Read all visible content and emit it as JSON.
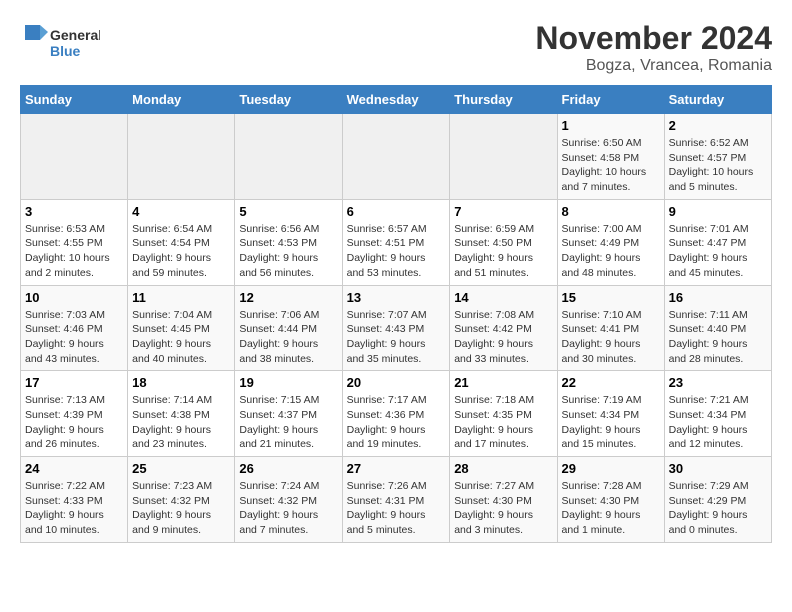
{
  "logo": {
    "line1": "General",
    "line2": "Blue"
  },
  "title": "November 2024",
  "location": "Bogza, Vrancea, Romania",
  "weekdays": [
    "Sunday",
    "Monday",
    "Tuesday",
    "Wednesday",
    "Thursday",
    "Friday",
    "Saturday"
  ],
  "weeks": [
    [
      {
        "day": "",
        "info": ""
      },
      {
        "day": "",
        "info": ""
      },
      {
        "day": "",
        "info": ""
      },
      {
        "day": "",
        "info": ""
      },
      {
        "day": "",
        "info": ""
      },
      {
        "day": "1",
        "info": "Sunrise: 6:50 AM\nSunset: 4:58 PM\nDaylight: 10 hours\nand 7 minutes."
      },
      {
        "day": "2",
        "info": "Sunrise: 6:52 AM\nSunset: 4:57 PM\nDaylight: 10 hours\nand 5 minutes."
      }
    ],
    [
      {
        "day": "3",
        "info": "Sunrise: 6:53 AM\nSunset: 4:55 PM\nDaylight: 10 hours\nand 2 minutes."
      },
      {
        "day": "4",
        "info": "Sunrise: 6:54 AM\nSunset: 4:54 PM\nDaylight: 9 hours\nand 59 minutes."
      },
      {
        "day": "5",
        "info": "Sunrise: 6:56 AM\nSunset: 4:53 PM\nDaylight: 9 hours\nand 56 minutes."
      },
      {
        "day": "6",
        "info": "Sunrise: 6:57 AM\nSunset: 4:51 PM\nDaylight: 9 hours\nand 53 minutes."
      },
      {
        "day": "7",
        "info": "Sunrise: 6:59 AM\nSunset: 4:50 PM\nDaylight: 9 hours\nand 51 minutes."
      },
      {
        "day": "8",
        "info": "Sunrise: 7:00 AM\nSunset: 4:49 PM\nDaylight: 9 hours\nand 48 minutes."
      },
      {
        "day": "9",
        "info": "Sunrise: 7:01 AM\nSunset: 4:47 PM\nDaylight: 9 hours\nand 45 minutes."
      }
    ],
    [
      {
        "day": "10",
        "info": "Sunrise: 7:03 AM\nSunset: 4:46 PM\nDaylight: 9 hours\nand 43 minutes."
      },
      {
        "day": "11",
        "info": "Sunrise: 7:04 AM\nSunset: 4:45 PM\nDaylight: 9 hours\nand 40 minutes."
      },
      {
        "day": "12",
        "info": "Sunrise: 7:06 AM\nSunset: 4:44 PM\nDaylight: 9 hours\nand 38 minutes."
      },
      {
        "day": "13",
        "info": "Sunrise: 7:07 AM\nSunset: 4:43 PM\nDaylight: 9 hours\nand 35 minutes."
      },
      {
        "day": "14",
        "info": "Sunrise: 7:08 AM\nSunset: 4:42 PM\nDaylight: 9 hours\nand 33 minutes."
      },
      {
        "day": "15",
        "info": "Sunrise: 7:10 AM\nSunset: 4:41 PM\nDaylight: 9 hours\nand 30 minutes."
      },
      {
        "day": "16",
        "info": "Sunrise: 7:11 AM\nSunset: 4:40 PM\nDaylight: 9 hours\nand 28 minutes."
      }
    ],
    [
      {
        "day": "17",
        "info": "Sunrise: 7:13 AM\nSunset: 4:39 PM\nDaylight: 9 hours\nand 26 minutes."
      },
      {
        "day": "18",
        "info": "Sunrise: 7:14 AM\nSunset: 4:38 PM\nDaylight: 9 hours\nand 23 minutes."
      },
      {
        "day": "19",
        "info": "Sunrise: 7:15 AM\nSunset: 4:37 PM\nDaylight: 9 hours\nand 21 minutes."
      },
      {
        "day": "20",
        "info": "Sunrise: 7:17 AM\nSunset: 4:36 PM\nDaylight: 9 hours\nand 19 minutes."
      },
      {
        "day": "21",
        "info": "Sunrise: 7:18 AM\nSunset: 4:35 PM\nDaylight: 9 hours\nand 17 minutes."
      },
      {
        "day": "22",
        "info": "Sunrise: 7:19 AM\nSunset: 4:34 PM\nDaylight: 9 hours\nand 15 minutes."
      },
      {
        "day": "23",
        "info": "Sunrise: 7:21 AM\nSunset: 4:34 PM\nDaylight: 9 hours\nand 12 minutes."
      }
    ],
    [
      {
        "day": "24",
        "info": "Sunrise: 7:22 AM\nSunset: 4:33 PM\nDaylight: 9 hours\nand 10 minutes."
      },
      {
        "day": "25",
        "info": "Sunrise: 7:23 AM\nSunset: 4:32 PM\nDaylight: 9 hours\nand 9 minutes."
      },
      {
        "day": "26",
        "info": "Sunrise: 7:24 AM\nSunset: 4:32 PM\nDaylight: 9 hours\nand 7 minutes."
      },
      {
        "day": "27",
        "info": "Sunrise: 7:26 AM\nSunset: 4:31 PM\nDaylight: 9 hours\nand 5 minutes."
      },
      {
        "day": "28",
        "info": "Sunrise: 7:27 AM\nSunset: 4:30 PM\nDaylight: 9 hours\nand 3 minutes."
      },
      {
        "day": "29",
        "info": "Sunrise: 7:28 AM\nSunset: 4:30 PM\nDaylight: 9 hours\nand 1 minute."
      },
      {
        "day": "30",
        "info": "Sunrise: 7:29 AM\nSunset: 4:29 PM\nDaylight: 9 hours\nand 0 minutes."
      }
    ]
  ]
}
